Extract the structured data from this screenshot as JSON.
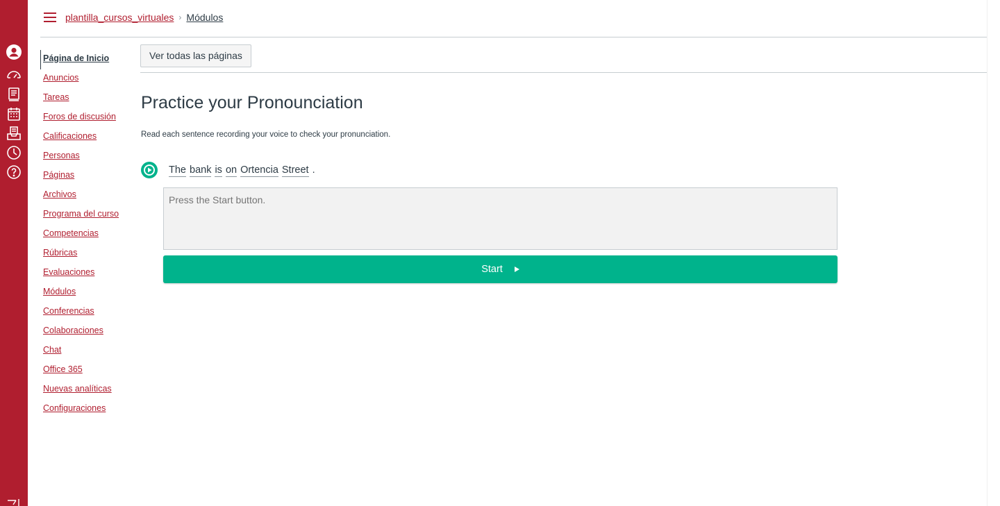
{
  "breadcrumb": {
    "course": "plantilla_cursos_virtuales",
    "separator": "›",
    "current": "Módulos"
  },
  "course_nav": [
    {
      "label": "Página de Inicio",
      "active": true
    },
    {
      "label": "Anuncios"
    },
    {
      "label": "Tareas"
    },
    {
      "label": "Foros de discusión"
    },
    {
      "label": "Calificaciones"
    },
    {
      "label": "Personas"
    },
    {
      "label": "Páginas"
    },
    {
      "label": "Archivos"
    },
    {
      "label": "Programa del curso"
    },
    {
      "label": "Competencias"
    },
    {
      "label": "Rúbricas"
    },
    {
      "label": "Evaluaciones"
    },
    {
      "label": "Módulos"
    },
    {
      "label": "Conferencias"
    },
    {
      "label": "Colaboraciones"
    },
    {
      "label": "Chat"
    },
    {
      "label": "Office 365"
    },
    {
      "label": "Nuevas analíticas"
    },
    {
      "label": "Configuraciones"
    }
  ],
  "toolbar": {
    "all_pages_label": "Ver todas las páginas"
  },
  "page": {
    "title": "Practice your Pronounciation",
    "intro": "Read each sentence recording your voice to check your pronunciation.",
    "sentence_words": [
      "The",
      "bank",
      "is",
      "on",
      "Ortencia",
      "Street"
    ],
    "sentence_end": ".",
    "result_placeholder": "Press the Start button.",
    "start_label": "Start"
  },
  "colors": {
    "brand": "#b01e2f",
    "accent": "#00b38c"
  },
  "global_nav_icons": [
    "account-icon",
    "dashboard-icon",
    "courses-icon",
    "calendar-icon",
    "inbox-icon",
    "history-icon",
    "help-icon"
  ]
}
